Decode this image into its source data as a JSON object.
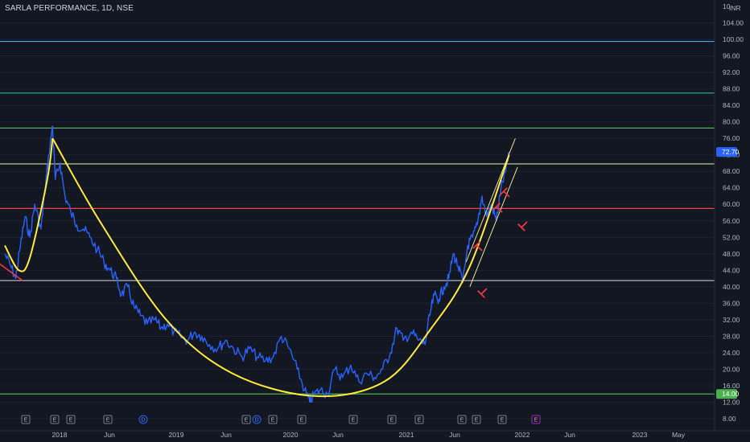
{
  "header": {
    "title": "SARLA PERFORMANCE, 1D, NSE"
  },
  "axis": {
    "currency": "INR",
    "currency_prefix": "10",
    "y_ticks": [
      "104.00",
      "100.00",
      "96.00",
      "92.00",
      "88.00",
      "84.00",
      "80.00",
      "76.00",
      "72.00",
      "68.00",
      "64.00",
      "60.00",
      "56.00",
      "52.00",
      "48.00",
      "44.00",
      "40.00",
      "36.00",
      "32.00",
      "28.00",
      "24.00",
      "20.00",
      "16.00",
      "12.00",
      "8.00"
    ],
    "x_ticks": [
      "2018",
      "Jun",
      "2019",
      "Jun",
      "2020",
      "Jun",
      "2021",
      "Jun",
      "2022",
      "Jun",
      "2023",
      "May"
    ],
    "price_badge": "72.70",
    "level_badge": "14.00"
  },
  "colors": {
    "background": "#131722",
    "price_line": "#2962ff",
    "cup_curve": "#ffeb3b",
    "badge_price": "#2962ff",
    "badge_level": "#4caf50",
    "arrow": "#f23645"
  },
  "chart_data": {
    "type": "line",
    "title": "SARLA PERFORMANCE, 1D, NSE",
    "ylim": [
      8,
      106
    ],
    "x_range": [
      "2017-08",
      "2023-08"
    ],
    "last_price": 72.7,
    "series": [
      {
        "name": "SARLA PERFORMANCE",
        "points": [
          [
            "2017-08-01",
            48
          ],
          [
            "2017-08-20",
            45
          ],
          [
            "2017-09-05",
            42
          ],
          [
            "2017-09-20",
            50
          ],
          [
            "2017-10-05",
            57
          ],
          [
            "2017-10-20",
            52
          ],
          [
            "2017-11-05",
            60
          ],
          [
            "2017-11-25",
            54
          ],
          [
            "2017-12-10",
            65
          ],
          [
            "2017-12-20",
            72
          ],
          [
            "2018-01-01",
            79
          ],
          [
            "2018-01-10",
            66
          ],
          [
            "2018-01-25",
            70
          ],
          [
            "2018-02-10",
            62
          ],
          [
            "2018-03-01",
            58
          ],
          [
            "2018-03-20",
            55
          ],
          [
            "2018-04-10",
            54
          ],
          [
            "2018-05-01",
            52
          ],
          [
            "2018-05-25",
            49
          ],
          [
            "2018-06-15",
            46
          ],
          [
            "2018-07-05",
            44
          ],
          [
            "2018-07-25",
            42
          ],
          [
            "2018-08-10",
            38
          ],
          [
            "2018-08-30",
            40
          ],
          [
            "2018-09-20",
            35
          ],
          [
            "2018-10-10",
            33
          ],
          [
            "2018-11-01",
            31
          ],
          [
            "2018-11-25",
            32
          ],
          [
            "2018-12-15",
            30
          ],
          [
            "2019-01-05",
            31
          ],
          [
            "2019-01-25",
            29
          ],
          [
            "2019-02-15",
            28
          ],
          [
            "2019-03-10",
            27
          ],
          [
            "2019-04-01",
            29
          ],
          [
            "2019-04-25",
            28
          ],
          [
            "2019-05-20",
            26
          ],
          [
            "2019-06-15",
            25
          ],
          [
            "2019-07-10",
            27
          ],
          [
            "2019-08-05",
            25
          ],
          [
            "2019-09-01",
            23
          ],
          [
            "2019-09-25",
            25
          ],
          [
            "2019-10-20",
            23
          ],
          [
            "2019-11-15",
            22
          ],
          [
            "2019-12-10",
            23
          ],
          [
            "2020-01-05",
            28
          ],
          [
            "2020-01-30",
            25
          ],
          [
            "2020-02-25",
            20
          ],
          [
            "2020-03-20",
            15
          ],
          [
            "2020-04-05",
            12
          ],
          [
            "2020-04-20",
            14
          ],
          [
            "2020-05-10",
            15
          ],
          [
            "2020-06-01",
            14
          ],
          [
            "2020-06-25",
            20
          ],
          [
            "2020-07-20",
            18
          ],
          [
            "2020-08-15",
            21
          ],
          [
            "2020-09-10",
            17
          ],
          [
            "2020-10-05",
            19
          ],
          [
            "2020-10-30",
            18
          ],
          [
            "2020-11-25",
            20
          ],
          [
            "2020-12-20",
            24
          ],
          [
            "2021-01-10",
            30
          ],
          [
            "2021-01-30",
            27
          ],
          [
            "2021-02-25",
            29
          ],
          [
            "2021-03-20",
            27
          ],
          [
            "2021-04-10",
            26
          ],
          [
            "2021-04-25",
            33
          ],
          [
            "2021-05-10",
            38
          ],
          [
            "2021-05-25",
            37
          ],
          [
            "2021-06-10",
            40
          ],
          [
            "2021-06-25",
            42
          ],
          [
            "2021-07-10",
            48
          ],
          [
            "2021-07-25",
            45
          ],
          [
            "2021-08-10",
            41
          ],
          [
            "2021-08-25",
            50
          ],
          [
            "2021-09-10",
            52
          ],
          [
            "2021-09-25",
            55
          ],
          [
            "2021-10-10",
            62
          ],
          [
            "2021-10-25",
            57
          ],
          [
            "2021-11-10",
            60
          ],
          [
            "2021-11-25",
            56
          ],
          [
            "2021-12-10",
            64
          ],
          [
            "2021-12-25",
            68
          ],
          [
            "2022-01-05",
            72.7
          ]
        ]
      }
    ],
    "horizontal_levels": [
      {
        "y": 99.5,
        "color": "#42a5f5"
      },
      {
        "y": 87.0,
        "color": "#26a69a"
      },
      {
        "y": 78.5,
        "color": "#66bb6a"
      },
      {
        "y": 69.8,
        "color": "#c5e1a5"
      },
      {
        "y": 59.0,
        "color": "#f44336"
      },
      {
        "y": 41.5,
        "color": "#b2b5be"
      },
      {
        "y": 14.0,
        "color": "#4caf50"
      }
    ],
    "cup_curves": [
      {
        "name": "left handle",
        "points": [
          [
            "2017-08-01",
            50
          ],
          [
            "2017-09-15",
            44
          ],
          [
            "2017-10-20",
            47
          ],
          [
            "2017-12-15",
            66
          ],
          [
            "2018-01-01",
            76
          ]
        ]
      },
      {
        "name": "cup",
        "points": [
          [
            "2018-01-01",
            76
          ],
          [
            "2018-06-01",
            56
          ],
          [
            "2019-01-01",
            32
          ],
          [
            "2019-08-01",
            19
          ],
          [
            "2020-04-20",
            13.5
          ],
          [
            "2020-12-01",
            17
          ],
          [
            "2021-05-01",
            30
          ],
          [
            "2021-09-01",
            45
          ],
          [
            "2022-01-05",
            72
          ]
        ]
      }
    ],
    "channel_lines": [
      {
        "from": [
          "2021-08-20",
          46
        ],
        "to": [
          "2022-01-25",
          76
        ]
      },
      {
        "from": [
          "2021-09-01",
          40
        ],
        "to": [
          "2022-02-01",
          69
        ]
      }
    ],
    "event_markers": [
      "E",
      "E",
      "E",
      "E",
      "D",
      "E",
      "D",
      "E",
      "E",
      "E",
      "E",
      "E",
      "E",
      "E",
      "E",
      "E"
    ]
  }
}
